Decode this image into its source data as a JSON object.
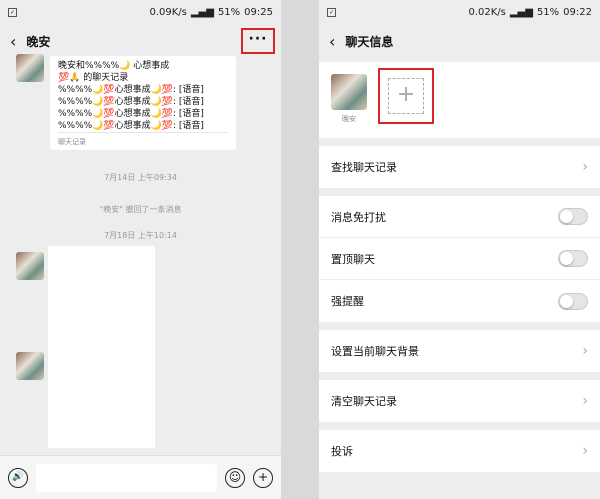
{
  "left": {
    "status": {
      "speed": "0.09K/s",
      "battery": "51%",
      "time": "09:25"
    },
    "nav": {
      "back": "‹",
      "title": "晚安",
      "more": "···"
    },
    "card": {
      "lines": [
        "晚安和%%%%🌙 心想事成",
        "💯🙏 的聊天记录",
        "%%%%🌙💯心想事成🌙💯: [语音]",
        "%%%%🌙💯心想事成🌙💯: [语音]",
        "%%%%🌙💯心想事成🌙💯: [语音]",
        "%%%%🌙💯心想事成🌙💯: [语音]"
      ],
      "footer": "聊天记录"
    },
    "timestamp1": "7月14日 上午09:34",
    "recall": "\"晚安\" 撤回了一条消息",
    "timestamp2": "7月18日 上午10:14",
    "input": {
      "voice": "🔊",
      "emoji": "☺",
      "plus": "+"
    }
  },
  "right": {
    "status": {
      "speed": "0.02K/s",
      "battery": "51%",
      "time": "09:22"
    },
    "nav": {
      "back": "‹",
      "title": "聊天信息"
    },
    "member_name": "晚安",
    "add": "+",
    "rows": {
      "find": "查找聊天记录",
      "mute": "消息免打扰",
      "pin": "置顶聊天",
      "alert": "强提醒",
      "bg": "设置当前聊天背景",
      "clear": "清空聊天记录",
      "report": "投诉"
    }
  },
  "colors": {
    "highlight": "#d9242c",
    "background": "#ededed"
  }
}
